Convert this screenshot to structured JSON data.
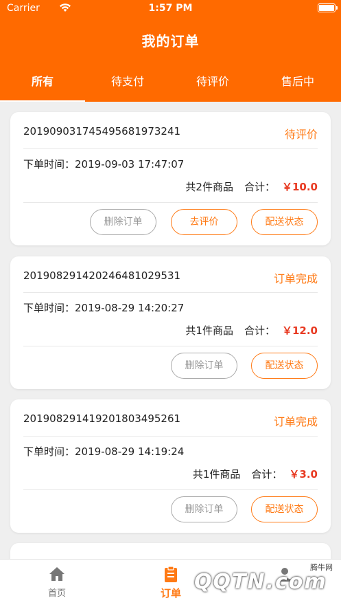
{
  "status_bar": {
    "carrier": "Carrier",
    "time": "1:57 PM"
  },
  "header": {
    "title": "我的订单"
  },
  "tabs": [
    {
      "label": "所有",
      "active": true
    },
    {
      "label": "待支付",
      "active": false
    },
    {
      "label": "待评价",
      "active": false
    },
    {
      "label": "售后中",
      "active": false
    }
  ],
  "orders": [
    {
      "order_no": "20190903174549568197324​1",
      "status": "待评价",
      "time_label": "下单时间：",
      "time": "2019-09-03 17:47:07",
      "count_text": "共2件商品",
      "total_label": "合计：",
      "price": "￥10.0",
      "buttons": [
        "删除订单",
        "去评价",
        "配送状态"
      ]
    },
    {
      "order_no": "201908291420246481029531",
      "status": "订单完成",
      "time_label": "下单时间：",
      "time": "2019-08-29 14:20:27",
      "count_text": "共1件商品",
      "total_label": "合计：",
      "price": "￥12.0",
      "buttons": [
        "删除订单",
        "配送状态"
      ]
    },
    {
      "order_no": "201908291419201803495261",
      "status": "订单完成",
      "time_label": "下单时间：",
      "time": "2019-08-29 14:19:24",
      "count_text": "共1件商品",
      "total_label": "合计：",
      "price": "￥3.0",
      "buttons": [
        "删除订单",
        "配送状态"
      ]
    }
  ],
  "tabbar": [
    {
      "label": "首页",
      "icon": "home-icon",
      "active": false
    },
    {
      "label": "订单",
      "icon": "clipboard-icon",
      "active": true
    }
  ],
  "watermark": {
    "site": "腾牛网",
    "logo": "QQTN.com"
  },
  "colors": {
    "brand": "#ff6a00",
    "accent": "#ff7a15",
    "price": "#e83a22"
  }
}
